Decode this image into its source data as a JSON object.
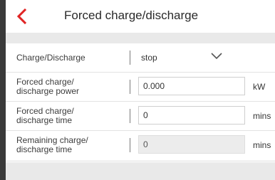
{
  "header": {
    "title": "Forced charge/discharge",
    "back_icon": "chevron-left-icon",
    "accent_color": "#e02424"
  },
  "form": {
    "mode": {
      "label": "Charge/Discharge",
      "value": "stop",
      "icon": "chevron-down-icon"
    },
    "power": {
      "label": "Forced charge/\ndischarge power",
      "value": "0.000",
      "unit": "kW"
    },
    "time": {
      "label": "Forced charge/\ndischarge time",
      "value": "0",
      "unit": "mins"
    },
    "remaining": {
      "label": "Remaining charge/\ndischarge time",
      "value": "0",
      "unit": "mins"
    }
  }
}
